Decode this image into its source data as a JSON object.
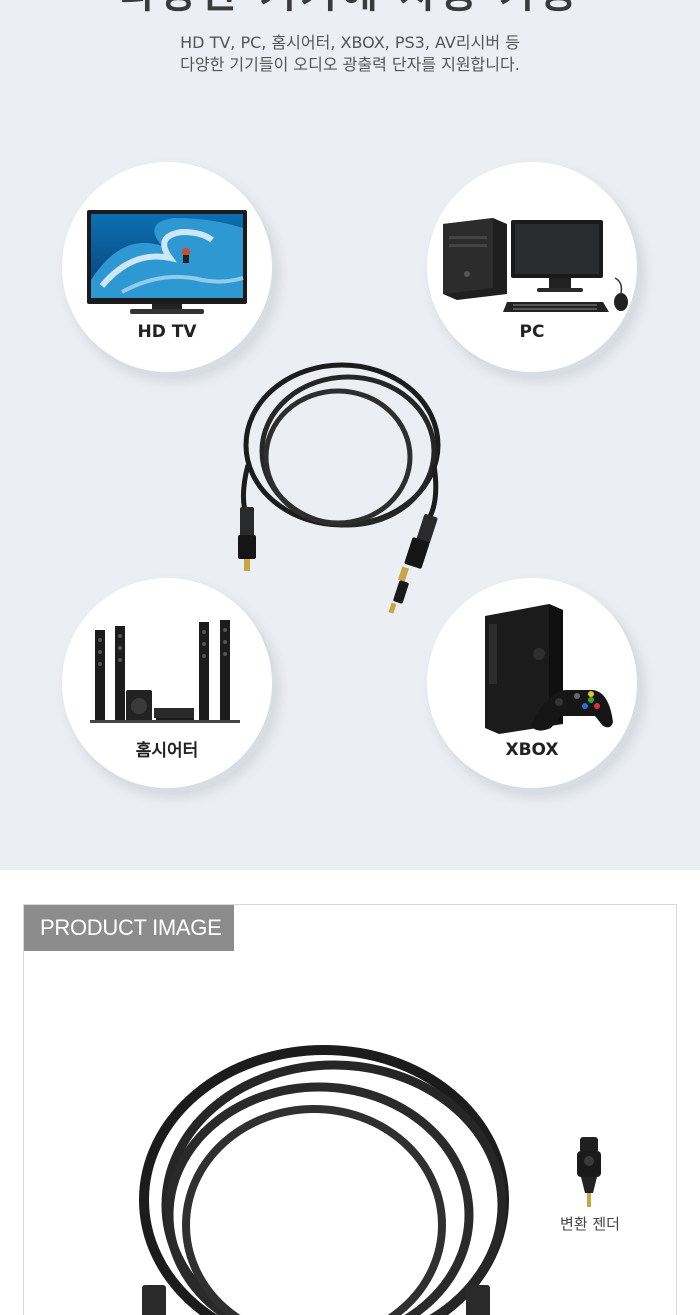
{
  "top": {
    "heading": "다양한 기기에 사용 가능",
    "description": [
      "HD TV, PC, 홈시어터, XBOX, PS3, AV리시버 등",
      "다양한 기기들이 오디오 광출력 단자를 지원합니다."
    ],
    "devices": [
      {
        "label": "HD TV",
        "icon": "hd-tv-icon"
      },
      {
        "label": "PC",
        "icon": "desktop-pc-icon"
      },
      {
        "label": "홈시어터",
        "icon": "home-theater-icon"
      },
      {
        "label": "XBOX",
        "icon": "xbox-console-icon"
      }
    ]
  },
  "product": {
    "tag": "PRODUCT IMAGE",
    "adapter_label": "변환 젠더"
  },
  "colors": {
    "section_bg": "#ebeff4",
    "tag_bg": "#8c8c8c",
    "cable": "#1c1c1c"
  }
}
